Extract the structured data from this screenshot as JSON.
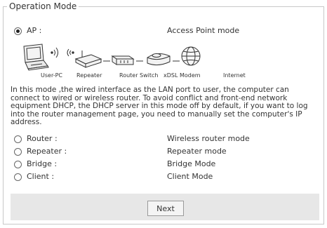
{
  "fieldset": {
    "legend": "Operation Mode"
  },
  "modes": [
    {
      "label": "AP :",
      "description": "Access Point mode",
      "checked": true
    },
    {
      "label": "Router :",
      "description": "Wireless router mode",
      "checked": false
    },
    {
      "label": "Repeater :",
      "description": "Repeater mode",
      "checked": false
    },
    {
      "label": "Bridge :",
      "description": "Bridge Mode",
      "checked": false
    },
    {
      "label": "Client :",
      "description": "Client Mode",
      "checked": false
    }
  ],
  "diagram": {
    "labels": [
      "User-PC",
      "Repeater",
      "Router Switch",
      "xDSL Modem",
      "Internet"
    ]
  },
  "paragraph": "In this mode ,the wired interface as the LAN port to user, the computer can connect to wired or wireless router. To avoid conflict and front-end network equipment DHCP, the DHCP server in this mode off by default, if you want to log into the router management page, you need to manually set the computer's IP address.",
  "buttons": {
    "next_label": "Next"
  }
}
